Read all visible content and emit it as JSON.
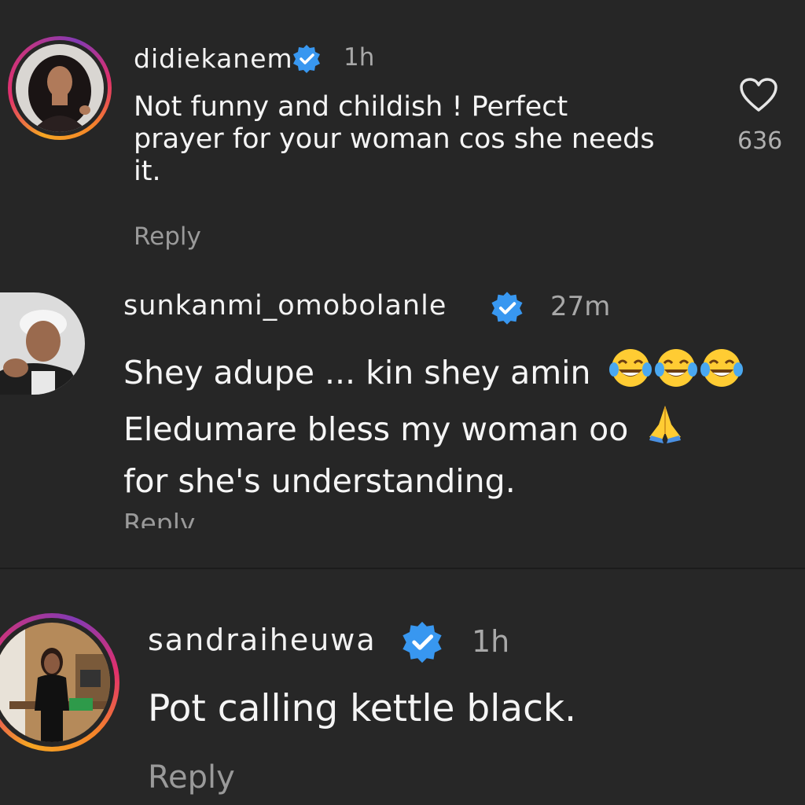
{
  "comments": [
    {
      "username": "didiekanem",
      "verified": true,
      "time": "1h",
      "text_lines": [
        "Not funny and childish !  Perfect",
        "prayer for your woman cos she needs",
        "it."
      ],
      "reply_label": "Reply",
      "like_count": "636",
      "icon": "heart-icon"
    },
    {
      "username": "sunkanmi_omobolanle",
      "verified": true,
      "time": "27m",
      "text_lines": [
        "Shey adupe ... kin shey amin",
        "Eledumare bless my woman oo",
        "for she's understanding."
      ],
      "emojis": [
        "tears-of-joy-emoji",
        "tears-of-joy-emoji",
        "tears-of-joy-emoji",
        "folded-hands-emoji"
      ],
      "reply_label": "Reply"
    },
    {
      "username": "sandraiheuwa",
      "verified": true,
      "time": "1h",
      "text": "Pot calling kettle black.",
      "reply_label": "Reply"
    }
  ],
  "colors": {
    "background": "#262626",
    "verified_blue": "#3897f0",
    "story_ring": [
      "#f5a623",
      "#e1306c",
      "#833ab4"
    ]
  }
}
